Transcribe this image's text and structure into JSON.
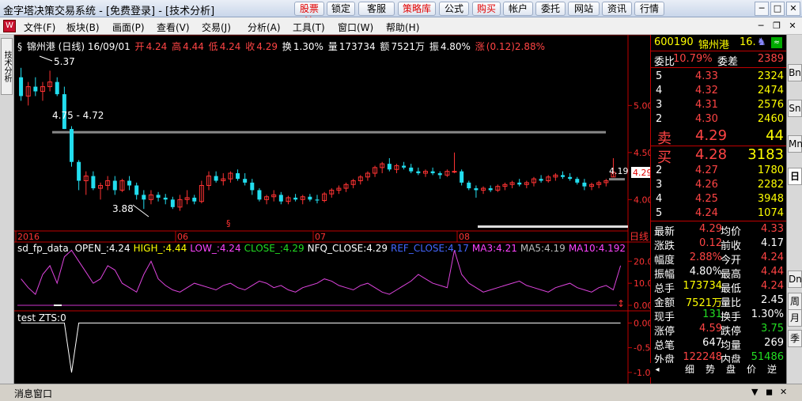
{
  "window": {
    "title": "金字塔决策交易系统 - [免费登录] - [技术分析]",
    "toolbar": [
      {
        "label": "股票池",
        "red": true
      },
      {
        "label": "锁定",
        "red": false
      },
      {
        "label": "客服",
        "red": false
      },
      {
        "label": "策略库",
        "red": true
      },
      {
        "label": "公式",
        "red": false
      },
      {
        "label": "购买",
        "red": true
      },
      {
        "label": "帐户",
        "red": false
      },
      {
        "label": "委托",
        "red": false
      },
      {
        "label": "网站",
        "red": false
      },
      {
        "label": "资讯",
        "red": false
      },
      {
        "label": "行情",
        "red": false
      }
    ]
  },
  "menu": {
    "items": [
      "文件(F)",
      "板块(B)",
      "画面(P)",
      "查看(V)",
      "交易(J)",
      "分析(A)",
      "工具(T)",
      "窗口(W)",
      "帮助(H)"
    ]
  },
  "left_tab": "技术分析",
  "header": {
    "name": "锦州港 (日线) 16/09/01",
    "open_label": "开",
    "open": "4.24",
    "high_label": "高",
    "high": "4.44",
    "low_label": "低",
    "low": "4.24",
    "close_label": "收",
    "close": "4.29",
    "turnover_label": "换",
    "turnover": "1.30%",
    "volume_label": "量",
    "volume": "173734",
    "amount_label": "额",
    "amount": "7521万",
    "amplitude_label": "振",
    "amplitude": "4.80%",
    "change_label": "涨",
    "change": "(0.12)2.88%"
  },
  "chart_data": [
    {
      "type": "candlestick",
      "annotations": [
        "5.37",
        "4.75 - 4.72",
        "3.88",
        "4.19",
        "4.29"
      ],
      "y_ticks": [
        "5.00",
        "4.50",
        "4.00"
      ],
      "x_ticks": [
        "2016",
        "06",
        "07",
        "08"
      ],
      "x_axis_label": "日线",
      "candles": [
        [
          5.3,
          5.4,
          5.05,
          5.1
        ],
        [
          5.1,
          5.25,
          5.0,
          5.2
        ],
        [
          5.2,
          5.3,
          5.1,
          5.15
        ],
        [
          5.15,
          5.25,
          5.05,
          5.2
        ],
        [
          5.2,
          5.37,
          5.15,
          5.25
        ],
        [
          5.25,
          5.3,
          5.1,
          5.12
        ],
        [
          5.12,
          5.2,
          4.75,
          4.75
        ],
        [
          4.75,
          4.78,
          4.35,
          4.4
        ],
        [
          4.4,
          4.42,
          4.1,
          4.2
        ],
        [
          4.2,
          4.3,
          4.05,
          4.25
        ],
        [
          4.25,
          4.3,
          4.1,
          4.12
        ],
        [
          4.12,
          4.18,
          4.0,
          4.15
        ],
        [
          4.15,
          4.25,
          4.1,
          4.2
        ],
        [
          4.2,
          4.25,
          4.05,
          4.1
        ],
        [
          4.1,
          4.22,
          4.08,
          4.2
        ],
        [
          4.2,
          4.25,
          4.1,
          4.15
        ],
        [
          4.15,
          4.18,
          4.0,
          4.05
        ],
        [
          4.05,
          4.1,
          3.9,
          4.0
        ],
        [
          4.0,
          4.1,
          3.95,
          4.05
        ],
        [
          4.05,
          4.08,
          3.98,
          4.02
        ],
        [
          4.02,
          4.06,
          3.95,
          4.0
        ],
        [
          4.0,
          4.03,
          3.9,
          3.92
        ],
        [
          3.92,
          4.05,
          3.88,
          4.0
        ],
        [
          4.0,
          4.1,
          3.95,
          4.02
        ],
        [
          4.02,
          4.05,
          3.95,
          3.98
        ],
        [
          3.98,
          4.2,
          3.96,
          4.15
        ],
        [
          4.15,
          4.3,
          4.1,
          4.25
        ],
        [
          4.25,
          4.3,
          4.18,
          4.2
        ],
        [
          4.2,
          4.28,
          4.15,
          4.22
        ],
        [
          4.22,
          4.3,
          4.18,
          4.28
        ],
        [
          4.28,
          4.32,
          4.2,
          4.22
        ],
        [
          4.22,
          4.28,
          4.15,
          4.18
        ],
        [
          4.18,
          4.22,
          4.05,
          4.1
        ],
        [
          4.1,
          4.12,
          3.98,
          4.0
        ],
        [
          4.0,
          4.05,
          3.95,
          4.03
        ],
        [
          4.03,
          4.1,
          3.98,
          4.05
        ],
        [
          4.05,
          4.08,
          3.95,
          3.98
        ],
        [
          3.98,
          4.04,
          3.95,
          4.02
        ],
        [
          4.02,
          4.06,
          3.98,
          4.0
        ],
        [
          4.0,
          4.05,
          3.95,
          4.03
        ],
        [
          4.03,
          4.06,
          3.98,
          4.0
        ],
        [
          4.0,
          4.05,
          3.96,
          3.99
        ],
        [
          3.99,
          4.08,
          3.97,
          4.06
        ],
        [
          4.06,
          4.12,
          4.02,
          4.1
        ],
        [
          4.1,
          4.15,
          4.06,
          4.12
        ],
        [
          4.12,
          4.18,
          4.08,
          4.16
        ],
        [
          4.16,
          4.22,
          4.12,
          4.2
        ],
        [
          4.2,
          4.26,
          4.16,
          4.24
        ],
        [
          4.24,
          4.3,
          4.2,
          4.28
        ],
        [
          4.28,
          4.36,
          4.24,
          4.34
        ],
        [
          4.34,
          4.4,
          4.28,
          4.38
        ],
        [
          4.38,
          4.44,
          4.3,
          4.32
        ],
        [
          4.32,
          4.38,
          4.28,
          4.36
        ],
        [
          4.36,
          4.4,
          4.32,
          4.34
        ],
        [
          4.34,
          4.38,
          4.28,
          4.3
        ],
        [
          4.3,
          4.34,
          4.26,
          4.28
        ],
        [
          4.28,
          4.32,
          4.24,
          4.3
        ],
        [
          4.3,
          4.34,
          4.26,
          4.28
        ],
        [
          4.28,
          4.3,
          4.22,
          4.26
        ],
        [
          4.26,
          4.32,
          4.24,
          4.3
        ],
        [
          4.3,
          4.5,
          4.28,
          4.3
        ],
        [
          4.3,
          4.32,
          4.15,
          4.18
        ],
        [
          4.18,
          4.2,
          4.1,
          4.12
        ],
        [
          4.12,
          4.15,
          4.02,
          4.1
        ],
        [
          4.1,
          4.14,
          4.06,
          4.12
        ],
        [
          4.12,
          4.15,
          4.08,
          4.1
        ],
        [
          4.1,
          4.16,
          4.08,
          4.14
        ],
        [
          4.14,
          4.18,
          4.1,
          4.16
        ],
        [
          4.16,
          4.2,
          4.12,
          4.18
        ],
        [
          4.18,
          4.22,
          4.14,
          4.16
        ],
        [
          4.16,
          4.2,
          4.12,
          4.18
        ],
        [
          4.18,
          4.24,
          4.14,
          4.22
        ],
        [
          4.22,
          4.26,
          4.18,
          4.2
        ],
        [
          4.2,
          4.26,
          4.18,
          4.24
        ],
        [
          4.24,
          4.28,
          4.2,
          4.26
        ],
        [
          4.26,
          4.3,
          4.22,
          4.24
        ],
        [
          4.24,
          4.28,
          4.2,
          4.22
        ],
        [
          4.22,
          4.24,
          4.16,
          4.18
        ],
        [
          4.18,
          4.22,
          4.1,
          4.14
        ],
        [
          4.14,
          4.18,
          4.1,
          4.16
        ],
        [
          4.16,
          4.2,
          4.12,
          4.18
        ],
        [
          4.18,
          4.22,
          4.14,
          4.2
        ],
        [
          4.24,
          4.44,
          4.24,
          4.29
        ]
      ]
    },
    {
      "type": "line",
      "title": "sd_fp_data",
      "y_ticks": [
        "20.0",
        "10.0",
        "0.00"
      ],
      "legend": [
        {
          "text": "OPEN_:4.24",
          "color": "#ffffff"
        },
        {
          "text": "HIGH_:4.44",
          "color": "#ffff00"
        },
        {
          "text": "LOW_:4.24",
          "color": "#ff44ff"
        },
        {
          "text": "CLOSE_:4.29",
          "color": "#22dd22"
        },
        {
          "text": "NFQ_CLOSE:4.29",
          "color": "#ffffff"
        },
        {
          "text": "REF_CLOSE:4.17",
          "color": "#4466ff"
        },
        {
          "text": "MA3:4.21",
          "color": "#ff44ff"
        },
        {
          "text": "MA5:4.19",
          "color": "#bbbbbb"
        },
        {
          "text": "MA10:4.192",
          "color": "#ff44ff"
        }
      ],
      "series_values": [
        12,
        8,
        5,
        14,
        18,
        10,
        22,
        25,
        20,
        15,
        10,
        12,
        18,
        16,
        10,
        8,
        6,
        14,
        20,
        12,
        9,
        7,
        6,
        8,
        10,
        9,
        8,
        7,
        9,
        10,
        8,
        7,
        9,
        11,
        10,
        8,
        9,
        7,
        6,
        8,
        9,
        10,
        12,
        11,
        9,
        8,
        7,
        9,
        10,
        8,
        6,
        5,
        7,
        9,
        11,
        14,
        12,
        10,
        9,
        8,
        25,
        14,
        10,
        8,
        6,
        7,
        8,
        9,
        10,
        11,
        9,
        8,
        7,
        6,
        8,
        9,
        10,
        8,
        7,
        6,
        8,
        9,
        7,
        18
      ]
    },
    {
      "type": "line",
      "title": "test ZTS:0",
      "y_ticks": [
        "0.00",
        "-0.50",
        "-1.00"
      ],
      "series_values": [
        0,
        0,
        0,
        0,
        0,
        0,
        0,
        -1,
        0,
        0,
        0,
        0,
        0,
        0,
        0,
        0,
        0,
        0,
        0,
        0,
        0,
        0,
        0,
        0,
        0,
        0,
        0,
        0,
        0,
        0,
        0,
        0,
        0,
        0,
        0,
        0,
        0,
        0,
        0,
        0,
        0,
        0,
        0,
        0,
        0,
        0,
        0,
        0,
        0,
        0,
        0,
        0,
        0,
        0,
        0,
        0,
        0,
        0,
        0,
        0,
        0,
        0,
        0,
        0,
        0,
        0,
        0,
        0,
        0,
        0,
        0,
        0,
        0,
        0,
        0,
        0,
        0,
        0,
        0,
        0,
        0,
        0,
        0,
        0
      ]
    }
  ],
  "quote": {
    "code": "600190",
    "name": "锦州港",
    "extra": "16.",
    "weibi_label": "委比",
    "weibi": "10.79%",
    "weicha_label": "委差",
    "weicha": "2389",
    "sell": [
      {
        "lvl": "5",
        "price": "4.33",
        "vol": "2324"
      },
      {
        "lvl": "4",
        "price": "4.32",
        "vol": "2474"
      },
      {
        "lvl": "3",
        "price": "4.31",
        "vol": "2576"
      },
      {
        "lvl": "2",
        "price": "4.30",
        "vol": "2460"
      }
    ],
    "sell1_label": "卖",
    "sell1_price": "4.29",
    "sell1_vol": "44",
    "buy1_label": "买",
    "buy1_price": "4.28",
    "buy1_vol": "3183",
    "buy": [
      {
        "lvl": "2",
        "price": "4.27",
        "vol": "1780"
      },
      {
        "lvl": "3",
        "price": "4.26",
        "vol": "2282"
      },
      {
        "lvl": "4",
        "price": "4.25",
        "vol": "3948"
      },
      {
        "lvl": "5",
        "price": "4.24",
        "vol": "1074"
      }
    ],
    "stats": [
      {
        "l1": "最新",
        "v1": "4.29",
        "c1": "red",
        "l2": "均价",
        "v2": "4.33",
        "c2": "red"
      },
      {
        "l1": "涨跌",
        "v1": "0.12",
        "c1": "red",
        "l2": "前收",
        "v2": "4.17",
        "c2": "wht"
      },
      {
        "l1": "幅度",
        "v1": "2.88%",
        "c1": "red",
        "l2": "今开",
        "v2": "4.24",
        "c2": "red"
      },
      {
        "l1": "振幅",
        "v1": "4.80%",
        "c1": "wht",
        "l2": "最高",
        "v2": "4.44",
        "c2": "red"
      },
      {
        "l1": "总手",
        "v1": "173734",
        "c1": "yel",
        "l2": "最低",
        "v2": "4.24",
        "c2": "red"
      },
      {
        "l1": "金额",
        "v1": "7521万",
        "c1": "yel",
        "l2": "量比",
        "v2": "2.45",
        "c2": "wht"
      },
      {
        "l1": "现手",
        "v1": "131",
        "c1": "grn",
        "l2": "换手",
        "v2": "1.30%",
        "c2": "wht"
      },
      {
        "l1": "涨停",
        "v1": "4.59",
        "c1": "red",
        "l2": "跌停",
        "v2": "3.75",
        "c2": "grn"
      },
      {
        "l1": "总笔",
        "v1": "647",
        "c1": "wht",
        "l2": "均量",
        "v2": "269",
        "c2": "wht"
      },
      {
        "l1": "外盘",
        "v1": "122248",
        "c1": "red",
        "l2": "内盘",
        "v2": "51486",
        "c2": "grn"
      }
    ],
    "bottom_tabs": [
      "细",
      "势",
      "盘",
      "价",
      "逆"
    ]
  },
  "right_tabs": [
    "Bn",
    "Sn",
    "Mn",
    "日",
    "Dn",
    "周",
    "月",
    "季"
  ],
  "message": {
    "label": "消息窗口"
  }
}
